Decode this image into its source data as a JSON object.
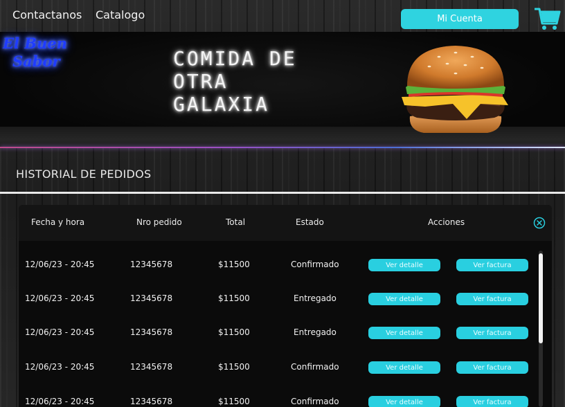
{
  "nav": {
    "contact": "Contactanos",
    "catalog": "Catalogo",
    "account": "Mi Cuenta"
  },
  "hero": {
    "logo_line1": "El Buen",
    "logo_line2": "Sabor",
    "title": "COMIDA DE\nOTRA\nGALAXIA"
  },
  "section": {
    "title": "HISTORIAL DE PEDIDOS"
  },
  "table": {
    "headers": {
      "date": "Fecha y hora",
      "order": "Nro pedido",
      "total": "Total",
      "status": "Estado",
      "actions": "Acciones"
    },
    "rows": [
      {
        "date": "12/06/23 - 20:45",
        "order": "12345678",
        "total": "$11500",
        "status": "Confirmado",
        "detail": "Ver detalle",
        "invoice": "Ver factura"
      },
      {
        "date": "12/06/23 - 20:45",
        "order": "12345678",
        "total": "$11500",
        "status": "Entregado",
        "detail": "Ver detalle",
        "invoice": "Ver factura"
      },
      {
        "date": "12/06/23 - 20:45",
        "order": "12345678",
        "total": "$11500",
        "status": "Entregado",
        "detail": "Ver detalle",
        "invoice": "Ver factura"
      },
      {
        "date": "12/06/23 - 20:45",
        "order": "12345678",
        "total": "$11500",
        "status": "Confirmado",
        "detail": "Ver detalle",
        "invoice": "Ver factura"
      },
      {
        "date": "12/06/23 - 20:45",
        "order": "12345678",
        "total": "$11500",
        "status": "Confirmado",
        "detail": "Ver detalle",
        "invoice": "Ver factura"
      }
    ]
  },
  "colors": {
    "accent": "#2fd3e0",
    "logo_neon": "#1f3cff"
  },
  "icons": {
    "cart": "shopping-cart-icon",
    "close": "close-circle-icon",
    "burger": "burger-image"
  }
}
